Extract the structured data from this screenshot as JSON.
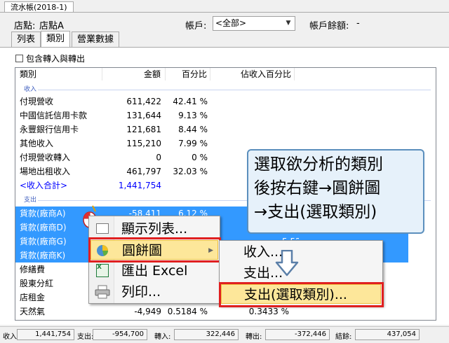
{
  "window": {
    "tab_title": "流水帳(2018-1)"
  },
  "header": {
    "store_label": "店點:",
    "store_value": "店點A",
    "account_label": "帳戶:",
    "account_select": "<全部>",
    "balance_label": "帳戶餘額:",
    "balance_value": "-"
  },
  "tabs": [
    {
      "label": "列表"
    },
    {
      "label": "類別"
    },
    {
      "label": "營業數據"
    }
  ],
  "filter": {
    "include_transfer": "包含轉入與轉出"
  },
  "list": {
    "columns": [
      "類別",
      "金額",
      "百分比",
      "佔收入百分比"
    ],
    "income_group": "收入",
    "income_rows": [
      {
        "name": "付現營收",
        "amount": "611,422",
        "pct": "42.41 %"
      },
      {
        "name": "中國信託信用卡款",
        "amount": "131,644",
        "pct": "9.13 %"
      },
      {
        "name": "永豐銀行信用卡",
        "amount": "121,681",
        "pct": "8.44 %"
      },
      {
        "name": "其他收入",
        "amount": "115,210",
        "pct": "7.99 %"
      },
      {
        "name": "付現營收轉入",
        "amount": "0",
        "pct": "0 %"
      },
      {
        "name": "場地出租收入",
        "amount": "461,797",
        "pct": "32.03 %"
      }
    ],
    "income_total": {
      "name": "<收入合計>",
      "amount": "1,441,754"
    },
    "expense_group": "支出",
    "expense_selected": [
      {
        "name": "貨款(廠商A)",
        "amount": "-58,411",
        "pct": "6.12 %"
      },
      {
        "name": "貨款(廠商D)"
      },
      {
        "name": "貨款(廠商G)",
        "pct_tail": "5.52 %"
      },
      {
        "name": "貨款(廠商K)"
      }
    ],
    "expense_rows": [
      {
        "name": "修繕費"
      },
      {
        "name": "股東分紅"
      },
      {
        "name": "店租金"
      },
      {
        "name": "天然氣",
        "amount": "-4,949",
        "pct": "0.5184 %",
        "income_pct": "0.3433 %"
      }
    ]
  },
  "context_menu": {
    "items": [
      {
        "label": "顯示列表...",
        "icon": "table-icon"
      },
      {
        "label": "圓餅圖",
        "icon": "pie-chart-icon"
      },
      {
        "label": "匯出 Excel",
        "icon": "excel-icon"
      },
      {
        "label": "列印...",
        "icon": "printer-icon"
      }
    ],
    "submenu": [
      {
        "label": "收入..."
      },
      {
        "label": "支出..."
      },
      {
        "label": "支出(選取類別)..."
      }
    ]
  },
  "callout": {
    "line1": "選取欲分析的類別",
    "line2": "後按右鍵→圓餅圖",
    "line3": "→支出(選取類別)"
  },
  "status": {
    "income_label": "收入:",
    "income_value": "1,441,754",
    "expense_label": "支出:",
    "expense_value": "-954,700",
    "transfer_in_label": "轉入:",
    "transfer_in_value": "322,446",
    "transfer_out_label": "轉出:",
    "transfer_out_value": "-372,446",
    "balance_label": "結餘:",
    "balance_value": "437,054"
  },
  "colors": {
    "selection": "#3399ff",
    "highlight_border": "#e02020",
    "menu_hover": "#fde79a",
    "callout_bg": "#e6f1fa"
  }
}
